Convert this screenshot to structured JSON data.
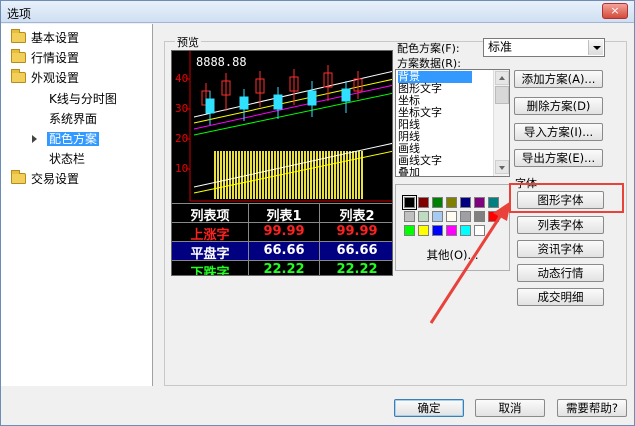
{
  "window": {
    "title": "选项",
    "close_label": "×"
  },
  "tree": [
    {
      "label": "基本设置",
      "type": "folder"
    },
    {
      "label": "行情设置",
      "type": "folder"
    },
    {
      "label": "外观设置",
      "type": "folder"
    },
    {
      "label": "K线与分时图",
      "type": "child"
    },
    {
      "label": "系统界面",
      "type": "child"
    },
    {
      "label": "配色方案",
      "type": "child",
      "selected": true
    },
    {
      "label": "状态栏",
      "type": "child"
    },
    {
      "label": "交易设置",
      "type": "folder"
    }
  ],
  "preview": {
    "label": "预览",
    "top_value": "8888.88",
    "axis_labels": [
      "40",
      "30",
      "20",
      "10"
    ],
    "table_header": [
      "列表项",
      "列表1",
      "列表2"
    ],
    "rows": [
      {
        "name": "上涨字",
        "v1": "99.99",
        "v2": "99.99",
        "color": "#ff2020",
        "bg": "#000000"
      },
      {
        "name": "平盘字",
        "v1": "66.66",
        "v2": "66.66",
        "color": "#ffffff",
        "bg": "#000080"
      },
      {
        "name": "下跌字",
        "v1": "22.22",
        "v2": "22.22",
        "color": "#20ff20",
        "bg": "#000000"
      }
    ]
  },
  "scheme": {
    "scheme_label": "配色方案(F):",
    "scheme_value": "标准",
    "data_label": "方案数据(R):",
    "items": [
      "背景",
      "图形文字",
      "坐标",
      "坐标文字",
      "阳线",
      "阴线",
      "画线",
      "画线文字",
      "叠加"
    ],
    "selected_index": 0
  },
  "palette": {
    "colors": [
      "#000000",
      "#800000",
      "#008000",
      "#808000",
      "#000080",
      "#800080",
      "#008080",
      "#c0c0c0",
      "#c0dcc0",
      "#a6caf0",
      "#fffbf0",
      "#a0a0a4",
      "#808080",
      "#ff0000",
      "#00ff00",
      "#ffff00",
      "#0000ff",
      "#ff00ff",
      "#00ffff",
      "#ffffff"
    ],
    "selected_index": 0,
    "other_label": "其他(O)..."
  },
  "scheme_buttons": [
    "添加方案(A)...",
    "删除方案(D)",
    "导入方案(I)...",
    "导出方案(E)..."
  ],
  "font_group_label": "字体",
  "font_buttons": [
    "图形字体",
    "列表字体",
    "资讯字体",
    "动态行情",
    "成交明细"
  ],
  "footer": {
    "ok": "确定",
    "cancel": "取消",
    "help": "需要帮助?"
  },
  "accent": "#e8423a"
}
